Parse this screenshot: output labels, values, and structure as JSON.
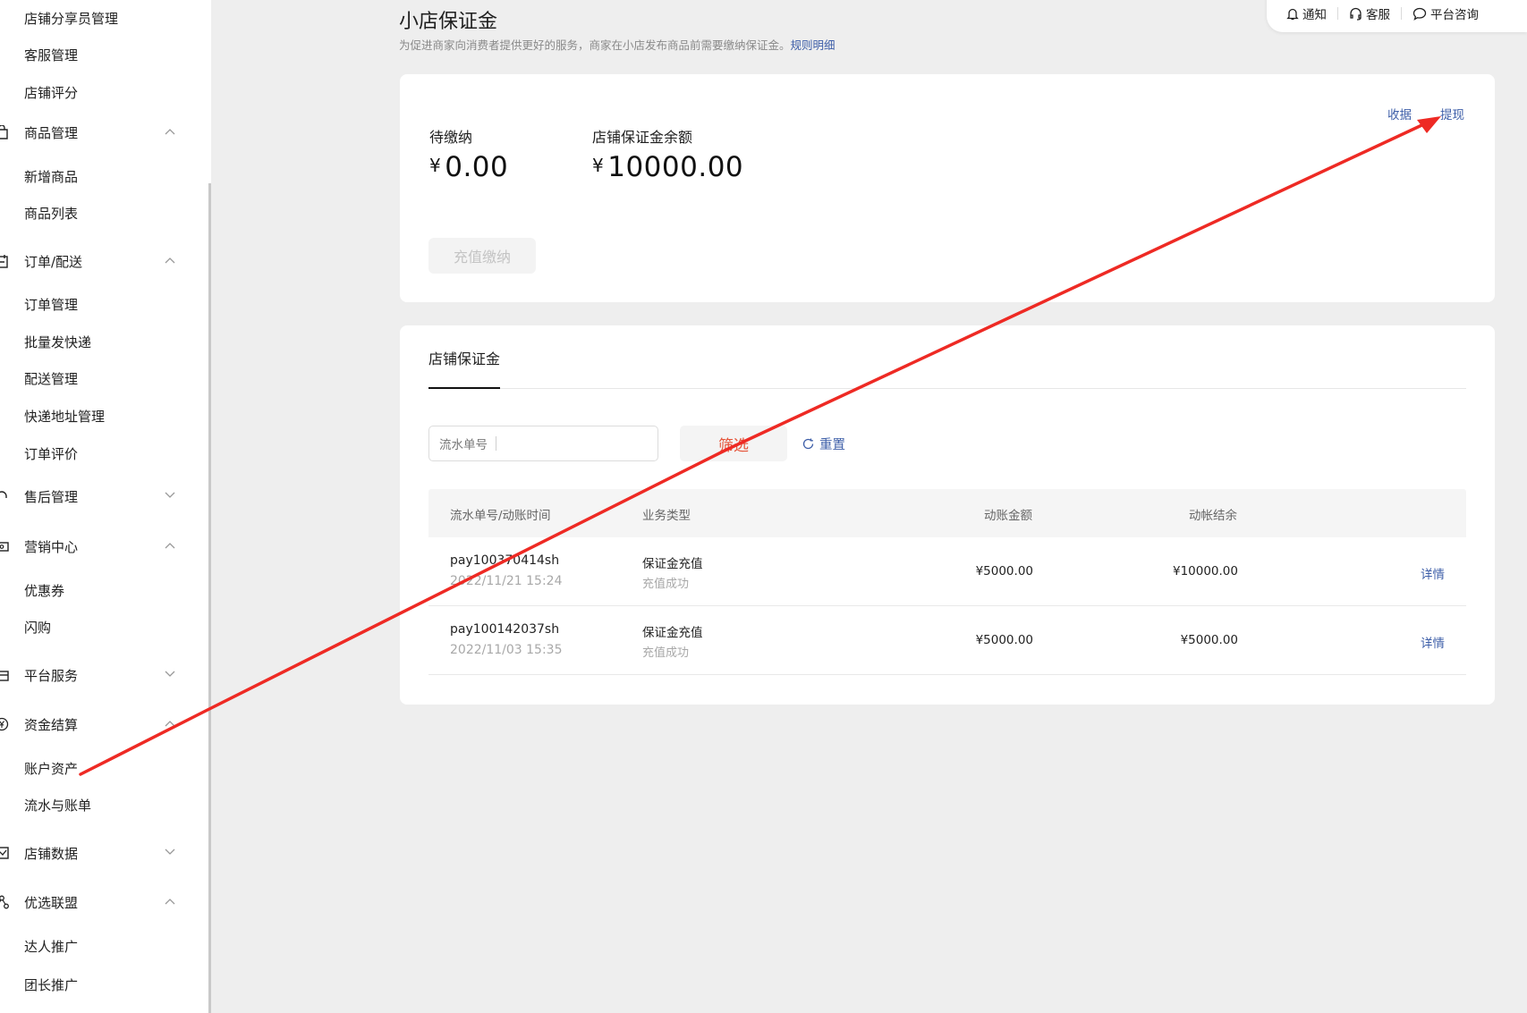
{
  "sidebar": {
    "items": [
      {
        "label": "店铺分享员管理"
      },
      {
        "label": "客服管理"
      },
      {
        "label": "店铺评分"
      },
      {
        "label": "商品管理"
      },
      {
        "label": "新增商品"
      },
      {
        "label": "商品列表"
      },
      {
        "label": "订单/配送"
      },
      {
        "label": "订单管理"
      },
      {
        "label": "批量发快递"
      },
      {
        "label": "配送管理"
      },
      {
        "label": "快递地址管理"
      },
      {
        "label": "订单评价"
      },
      {
        "label": "售后管理"
      },
      {
        "label": "营销中心"
      },
      {
        "label": "优惠券"
      },
      {
        "label": "闪购"
      },
      {
        "label": "平台服务"
      },
      {
        "label": "资金结算"
      },
      {
        "label": "账户资产"
      },
      {
        "label": "流水与账单"
      },
      {
        "label": "店铺数据"
      },
      {
        "label": "优选联盟"
      },
      {
        "label": "达人推广"
      },
      {
        "label": "团长推广"
      }
    ]
  },
  "topbar": {
    "notify": "通知",
    "service": "客服",
    "consult": "平台咨询"
  },
  "page": {
    "title": "小店保证金",
    "desc": "为促进商家向消费者提供更好的服务，商家在小店发布商品前需要缴纳保证金。",
    "rules_link": "规则明细"
  },
  "summary": {
    "pending_label": "待缴纳",
    "pending_currency": "¥",
    "pending_value": "0.00",
    "balance_label": "店铺保证金余额",
    "balance_currency": "¥",
    "balance_value": "10000.00",
    "collect_link": "收据",
    "withdraw_link": "提现",
    "recharge_button": "充值缴纳"
  },
  "ledger": {
    "tab": "店铺保证金",
    "search_placeholder": "流水单号",
    "filter_button": "筛选",
    "reset_button": "重置",
    "columns": [
      "流水单号/动账时间",
      "业务类型",
      "动账金额",
      "动帐结余"
    ],
    "rows": [
      {
        "id": "pay100370414sh",
        "time": "2022/11/21 15:24",
        "type": "保证金充值",
        "status": "充值成功",
        "amount": "¥5000.00",
        "balance": "¥10000.00",
        "action": "详情"
      },
      {
        "id": "pay100142037sh",
        "time": "2022/11/03 15:35",
        "type": "保证金充值",
        "status": "充值成功",
        "amount": "¥5000.00",
        "balance": "¥5000.00",
        "action": "详情"
      }
    ]
  },
  "colors": {
    "accent_link": "#3d5ea8",
    "filter_text": "#e5553b",
    "annotation_arrow": "#ee2a24"
  }
}
